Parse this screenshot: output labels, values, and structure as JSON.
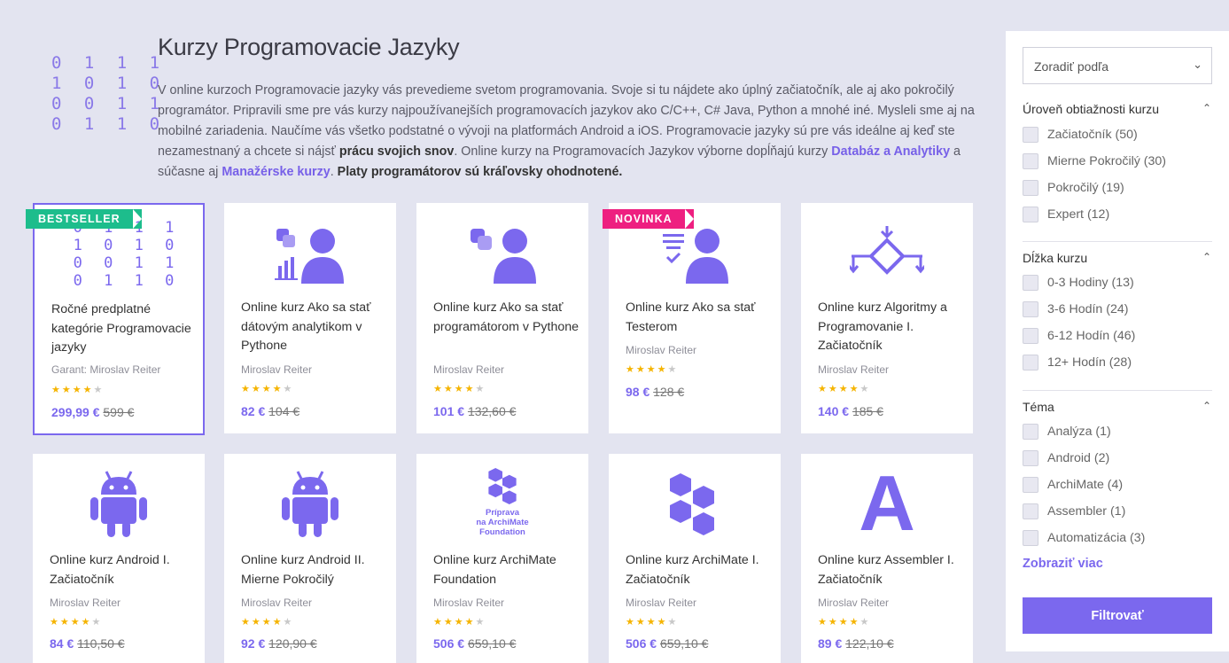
{
  "header": {
    "binary_logo": "0 1 1 1\n1 0 1 0\n0 0 1 1\n0 1 1 0",
    "title": "Kurzy Programovacie Jazyky",
    "intro_part1": "V online kurzoch Programovacie jazyky vás prevedieme svetom programovania. Svoje si tu nájdete ako úplný začiatočník, ale aj ako pokročilý programátor. Pripravili sme pre vás kurzy najpoužívanejších programovacích jazykov ako C/C++, C# Java, Python a mnohé iné. Mysleli sme aj na mobilné zariadenia. Naučíme vás všetko podstatné o vývoji na platformách Android a iOS. Programovacie jazyky sú pre vás ideálne aj keď ste nezamestnaný a chcete si nájsť ",
    "intro_bold1": "prácu svojich snov",
    "intro_part2": ". Online kurzy na Programovacích Jazykov výborne dopĺňajú kurzy ",
    "intro_link1": "Databáz a Analytiky",
    "intro_part3": " a súčasne aj ",
    "intro_link2": "Manažérske kurzy",
    "intro_part4": ". ",
    "intro_bold2": "Platy programátorov sú kráľovsky ohodnotené."
  },
  "badges": {
    "bestseller": "BESTSELLER",
    "novinka": "NOVINKA"
  },
  "cards": [
    {
      "title": "Ročné predplatné kategórie Programovacie jazyky",
      "author": "Garant: Miroslav Reiter",
      "stars": "★★★★",
      "half": "★",
      "price": "299,99 €",
      "old_price": "599 €"
    },
    {
      "title": "Online kurz Ako sa stať dátovým analytikom v Pythone",
      "author": "Miroslav Reiter",
      "stars": "★★★★",
      "half": "★",
      "price": "82 €",
      "old_price": "104 €"
    },
    {
      "title": "Online kurz Ako sa stať programátorom v Pythone",
      "author": "Miroslav Reiter",
      "stars": "★★★★",
      "half": "★",
      "price": "101 €",
      "old_price": "132,60 €"
    },
    {
      "title": "Online kurz Ako sa stať Testerom",
      "author": "Miroslav Reiter",
      "stars": "★★★★",
      "half": "★",
      "price": "98 €",
      "old_price": "128 €"
    },
    {
      "title": "Online kurz Algoritmy a Programovanie I. Začiatočník",
      "author": "Miroslav Reiter",
      "stars": "★★★★",
      "half": "★",
      "price": "140 €",
      "old_price": "185 €"
    },
    {
      "title": "Online kurz Android I. Začiatočník",
      "author": "Miroslav Reiter",
      "stars": "★★★★",
      "half": "★",
      "price": "84 €",
      "old_price": "110,50 €"
    },
    {
      "title": "Online kurz Android II. Mierne Pokročilý",
      "author": "Miroslav Reiter",
      "stars": "★★★★",
      "half": "★",
      "price": "92 €",
      "old_price": "120,90 €"
    },
    {
      "title": "Online kurz ArchiMate Foundation",
      "author": "Miroslav Reiter",
      "stars": "★★★★",
      "half": "★",
      "price": "506 €",
      "old_price": "659,10 €",
      "icon_text": "Príprava\nna ArchiMate\nFoundation"
    },
    {
      "title": "Online kurz ArchiMate I. Začiatočník",
      "author": "Miroslav Reiter",
      "stars": "★★★★",
      "half": "★",
      "price": "506 €",
      "old_price": "659,10 €"
    },
    {
      "title": "Online kurz Assembler I. Začiatočník",
      "author": "Miroslav Reiter",
      "stars": "★★★★",
      "half": "★",
      "price": "89 €",
      "old_price": "122,10 €",
      "icon_letter": "A"
    }
  ],
  "sidebar": {
    "sort_label": "Zoradiť podľa",
    "level": {
      "title": "Úroveň obtiažnosti kurzu",
      "items": [
        "Začiatočník (50)",
        "Mierne Pokročilý (30)",
        "Pokročilý (19)",
        "Expert (12)"
      ]
    },
    "length": {
      "title": "Dĺžka kurzu",
      "items": [
        "0-3 Hodiny (13)",
        "3-6 Hodín (24)",
        "6-12 Hodín (46)",
        "12+ Hodín (28)"
      ]
    },
    "topic": {
      "title": "Téma",
      "items": [
        "Analýza (1)",
        "Android (2)",
        "ArchiMate (4)",
        "Assembler (1)",
        "Automatizácia (3)"
      ]
    },
    "show_more": "Zobraziť viac",
    "filter_button": "Filtrovať"
  },
  "colors": {
    "accent": "#7b68ee",
    "bestseller": "#1dbd8c",
    "novinka": "#ee1f80",
    "stars": "#f5b400"
  }
}
